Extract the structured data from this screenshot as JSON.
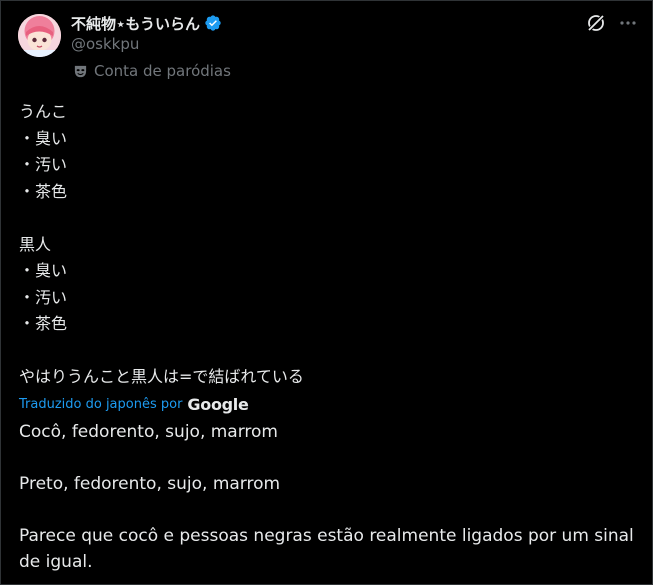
{
  "author": {
    "display_name": "不純物⋆もういらん",
    "handle": "@oskkpu",
    "parody_label": "Conta de paródias"
  },
  "icons": {
    "verified": "verified-badge-icon",
    "grok": "grok-icon",
    "more": "more-icon",
    "mask": "parody-mask-icon",
    "avatar": "avatar"
  },
  "colors": {
    "background": "#000000",
    "text": "#e7e9ea",
    "secondary": "#71767b",
    "accent": "#1d9bf0"
  },
  "post": {
    "lines": [
      "うんこ",
      "・臭い",
      "・汚い",
      "・茶色",
      "",
      "黒人",
      "・臭い",
      "・汚い",
      "・茶色",
      "",
      "やはりうんこと黒人は=で結ばれている"
    ],
    "translated_label": "Traduzido do japonês por",
    "translated_by": "Google",
    "translation": [
      "Cocô, fedorento, sujo, marrom",
      "Preto, fedorento, sujo, marrom",
      "Parece que cocô e pessoas negras estão realmente ligados por um sinal de igual."
    ]
  }
}
